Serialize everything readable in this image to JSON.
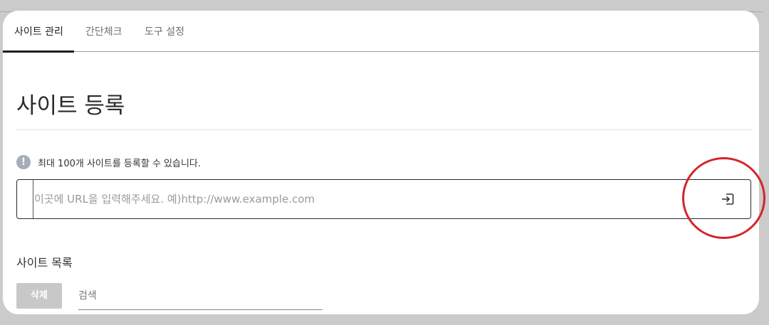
{
  "tabs": [
    {
      "label": "사이트 관리",
      "active": true
    },
    {
      "label": "간단체크",
      "active": false
    },
    {
      "label": "도구 설정",
      "active": false
    }
  ],
  "page": {
    "title": "사이트 등록"
  },
  "notice": {
    "icon": "info-icon",
    "icon_glyph": "!",
    "text": "최대 100개 사이트를 등록할 수 있습니다."
  },
  "url_form": {
    "placeholder": "이곳에 URL을 입력해주세요. 예)http://www.example.com",
    "submit_icon": "enter-icon"
  },
  "site_list": {
    "title": "사이트 목록",
    "delete_label": "삭제",
    "search_placeholder": "검색"
  },
  "colors": {
    "annotation_circle": "#d4252b",
    "active_tab": "#1f1f1f",
    "delete_button_bg": "#c8c8c8"
  }
}
